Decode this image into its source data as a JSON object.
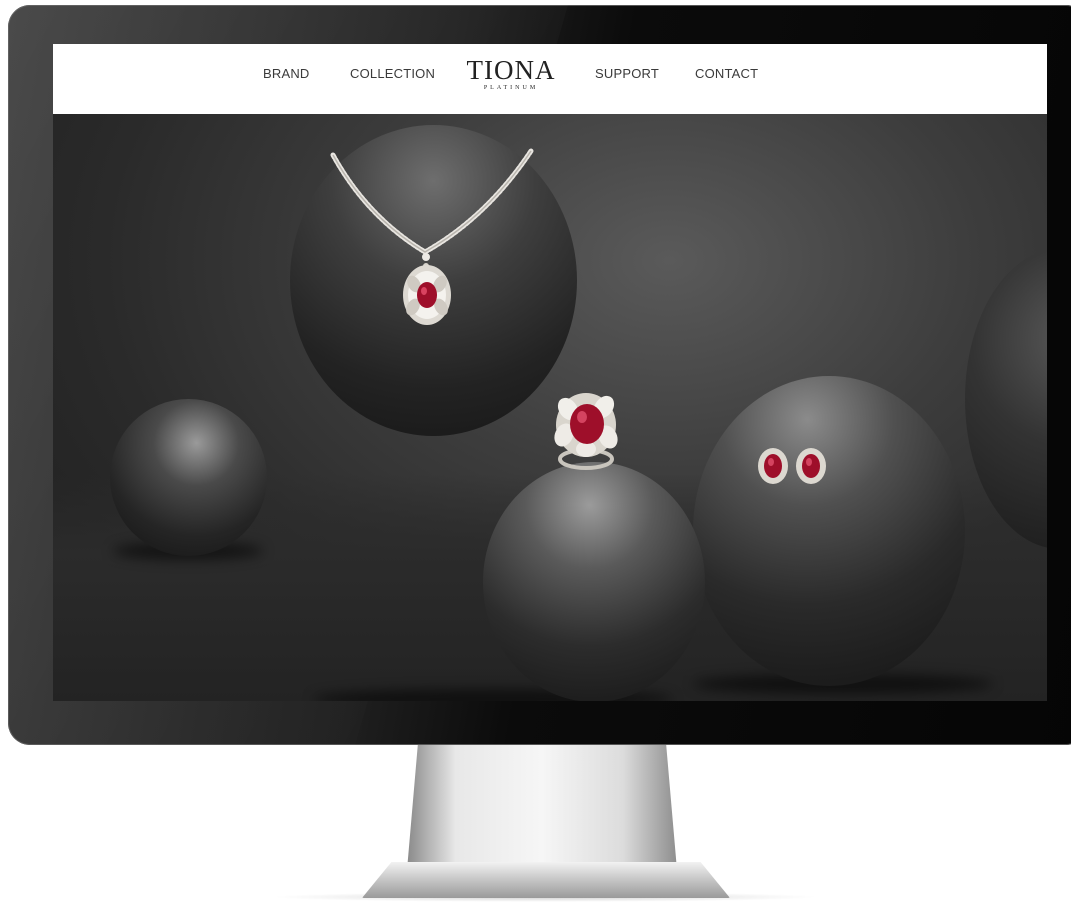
{
  "nav": {
    "brand_label": "BRAND",
    "collection_label": "COLLECTION",
    "support_label": "SUPPORT",
    "contact_label": "CONTACT"
  },
  "logo": {
    "name": "TIONA",
    "tagline": "PLATINUM"
  },
  "colors": {
    "nav_background": "#ffffff",
    "nav_text": "#3a3a3a",
    "bezel": "#0b0b0b",
    "ruby": "#9e0f2a"
  },
  "icons": {
    "logo": "tiona-logo-icon",
    "necklace": "necklace-image-icon",
    "ring": "ring-image-icon",
    "earrings": "earrings-image-icon"
  }
}
